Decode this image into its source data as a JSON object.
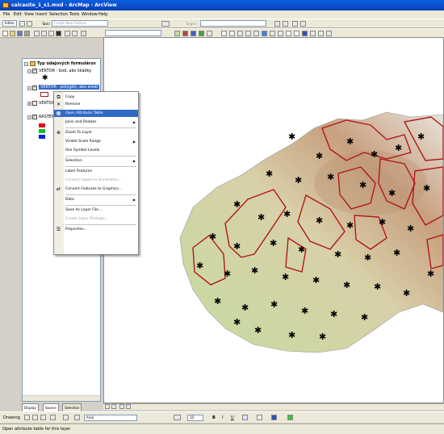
{
  "window": {
    "title": "calcasite_1_s1.mxd - ArcMap - ArcView"
  },
  "menu": [
    "File",
    "Edit",
    "View",
    "Insert",
    "Selection",
    "Tools",
    "Window",
    "Help"
  ],
  "editor": {
    "label": "Editor",
    "task_label": "Task:",
    "task_value": "Create New Feature",
    "target_label": "Target:"
  },
  "toc": {
    "root": "Typ údajových formulárov",
    "layers": [
      {
        "name": "VEKTOR - bod, ako škádky",
        "checked": true
      },
      {
        "name": "VEKTOR - polygón, ako areál",
        "checked": true
      },
      {
        "name": "VEKTOR",
        "checked": false
      },
      {
        "name": "RASTER",
        "checked": true
      }
    ],
    "tabs": [
      "Display",
      "Source",
      "Selection"
    ]
  },
  "context_menu": {
    "items": [
      {
        "label": "Copy",
        "icon": "copy-icon",
        "state": "normal"
      },
      {
        "label": "Remove",
        "icon": "remove-icon",
        "state": "normal"
      },
      {
        "label": "Open Attribute Table",
        "icon": "table-icon",
        "state": "selected"
      },
      {
        "label": "Joins and Relates",
        "submenu": true,
        "state": "normal"
      },
      {
        "label": "Zoom To Layer",
        "icon": "zoom-icon",
        "state": "normal"
      },
      {
        "label": "Visible Scale Range",
        "submenu": true,
        "state": "normal"
      },
      {
        "label": "Use Symbol Levels",
        "state": "normal"
      },
      {
        "label": "Selection",
        "submenu": true,
        "state": "normal"
      },
      {
        "label": "Label Features",
        "state": "normal"
      },
      {
        "label": "Convert Labels to Annotation...",
        "state": "disabled"
      },
      {
        "label": "Convert Features to Graphics...",
        "icon": "convert-icon",
        "state": "normal"
      },
      {
        "label": "Data",
        "submenu": true,
        "state": "normal"
      },
      {
        "label": "Save As Layer File...",
        "state": "normal"
      },
      {
        "label": "Create Layer Package...",
        "state": "disabled"
      },
      {
        "label": "Properties...",
        "icon": "properties-icon",
        "state": "normal"
      }
    ]
  },
  "drawing": {
    "label": "Drawing",
    "font": "Arial",
    "size": "10"
  },
  "status": {
    "text": "Open attribute table for this layer"
  },
  "colors": {
    "polygon_outline": "#b01818",
    "lowland": "#c8dca0",
    "selection": "#316ac5"
  }
}
